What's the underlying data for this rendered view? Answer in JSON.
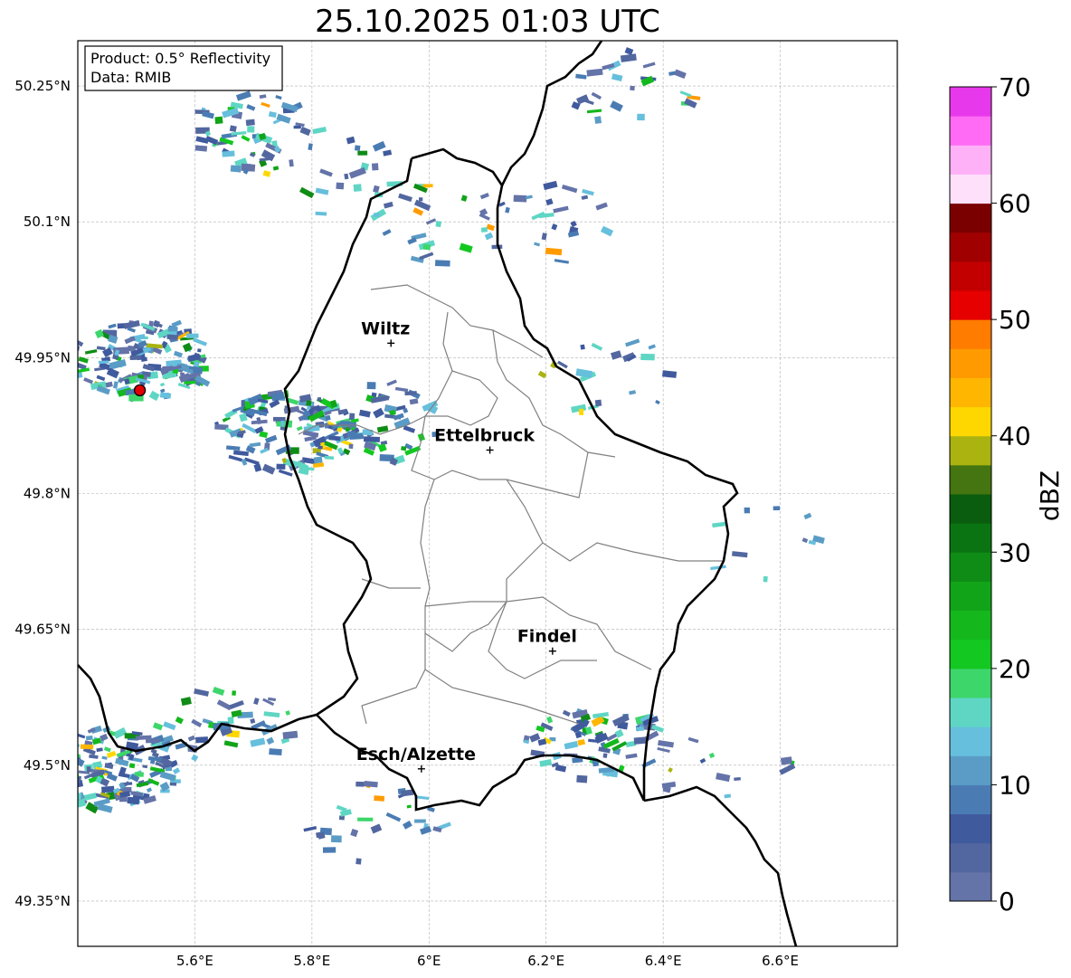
{
  "title": "25.10.2025 01:03 UTC",
  "info_box": {
    "product_line": "Product: 0.5° Reflectivity",
    "data_line": "Data: RMIB"
  },
  "axes": {
    "x_ticks": [
      {
        "value": 5.6,
        "label": "5.6°E"
      },
      {
        "value": 5.8,
        "label": "5.8°E"
      },
      {
        "value": 6.0,
        "label": "6°E"
      },
      {
        "value": 6.2,
        "label": "6.2°E"
      },
      {
        "value": 6.4,
        "label": "6.4°E"
      },
      {
        "value": 6.6,
        "label": "6.6°E"
      }
    ],
    "y_ticks": [
      {
        "value": 50.25,
        "label": "50.25°N"
      },
      {
        "value": 50.1,
        "label": "50.1°N"
      },
      {
        "value": 49.95,
        "label": "49.95°N"
      },
      {
        "value": 49.8,
        "label": "49.8°N"
      },
      {
        "value": 49.65,
        "label": "49.65°N"
      },
      {
        "value": 49.5,
        "label": "49.5°N"
      },
      {
        "value": 49.35,
        "label": "49.35°N"
      }
    ],
    "lon_range": [
      5.4,
      6.8
    ],
    "lat_range": [
      49.3,
      50.3
    ],
    "grid": true
  },
  "cities": [
    {
      "name": "Wiltz",
      "lon": 5.935,
      "lat": 49.966
    },
    {
      "name": "Ettelbruck",
      "lon": 6.104,
      "lat": 49.848
    },
    {
      "name": "Findel",
      "lon": 6.211,
      "lat": 49.626
    },
    {
      "name": "Esch/Alzette",
      "lon": 5.987,
      "lat": 49.496
    }
  ],
  "radar_site": {
    "lon": 5.506,
    "lat": 49.914,
    "color": "#e00000"
  },
  "colorbar": {
    "label": "dBZ",
    "min": 0,
    "max": 70,
    "ticks": [
      0,
      10,
      20,
      30,
      40,
      50,
      60,
      70
    ],
    "colors": [
      "#6473a8",
      "#52679f",
      "#405a9e",
      "#4a7cb3",
      "#5a9cc6",
      "#66bfdc",
      "#5fd6c4",
      "#3dd66b",
      "#13c820",
      "#14b81c",
      "#12a418",
      "#0f8c15",
      "#0a7412",
      "#0a5c0e",
      "#457510",
      "#aab310",
      "#ffd700",
      "#ffb600",
      "#ff9b00",
      "#ff7c00",
      "#e60000",
      "#c20000",
      "#a00000",
      "#7a0000",
      "#ffe0fb",
      "#ffb1f8",
      "#ff6bf4",
      "#e838eb"
    ]
  },
  "echo_clusters": [
    {
      "lon": 5.7,
      "lat": 50.2,
      "n": 60
    },
    {
      "lon": 5.85,
      "lat": 50.15,
      "n": 20
    },
    {
      "lon": 6.0,
      "lat": 50.1,
      "n": 25
    },
    {
      "lon": 6.2,
      "lat": 50.1,
      "n": 25
    },
    {
      "lon": 6.35,
      "lat": 50.25,
      "n": 25
    },
    {
      "lon": 5.5,
      "lat": 49.95,
      "n": 140
    },
    {
      "lon": 5.75,
      "lat": 49.87,
      "n": 120
    },
    {
      "lon": 5.9,
      "lat": 49.88,
      "n": 60
    },
    {
      "lon": 6.3,
      "lat": 49.93,
      "n": 20
    },
    {
      "lon": 5.45,
      "lat": 49.5,
      "n": 150
    },
    {
      "lon": 5.65,
      "lat": 49.55,
      "n": 40
    },
    {
      "lon": 5.9,
      "lat": 49.44,
      "n": 30
    },
    {
      "lon": 6.28,
      "lat": 49.53,
      "n": 70
    },
    {
      "lon": 6.5,
      "lat": 49.5,
      "n": 12
    },
    {
      "lon": 6.55,
      "lat": 49.75,
      "n": 10
    }
  ]
}
